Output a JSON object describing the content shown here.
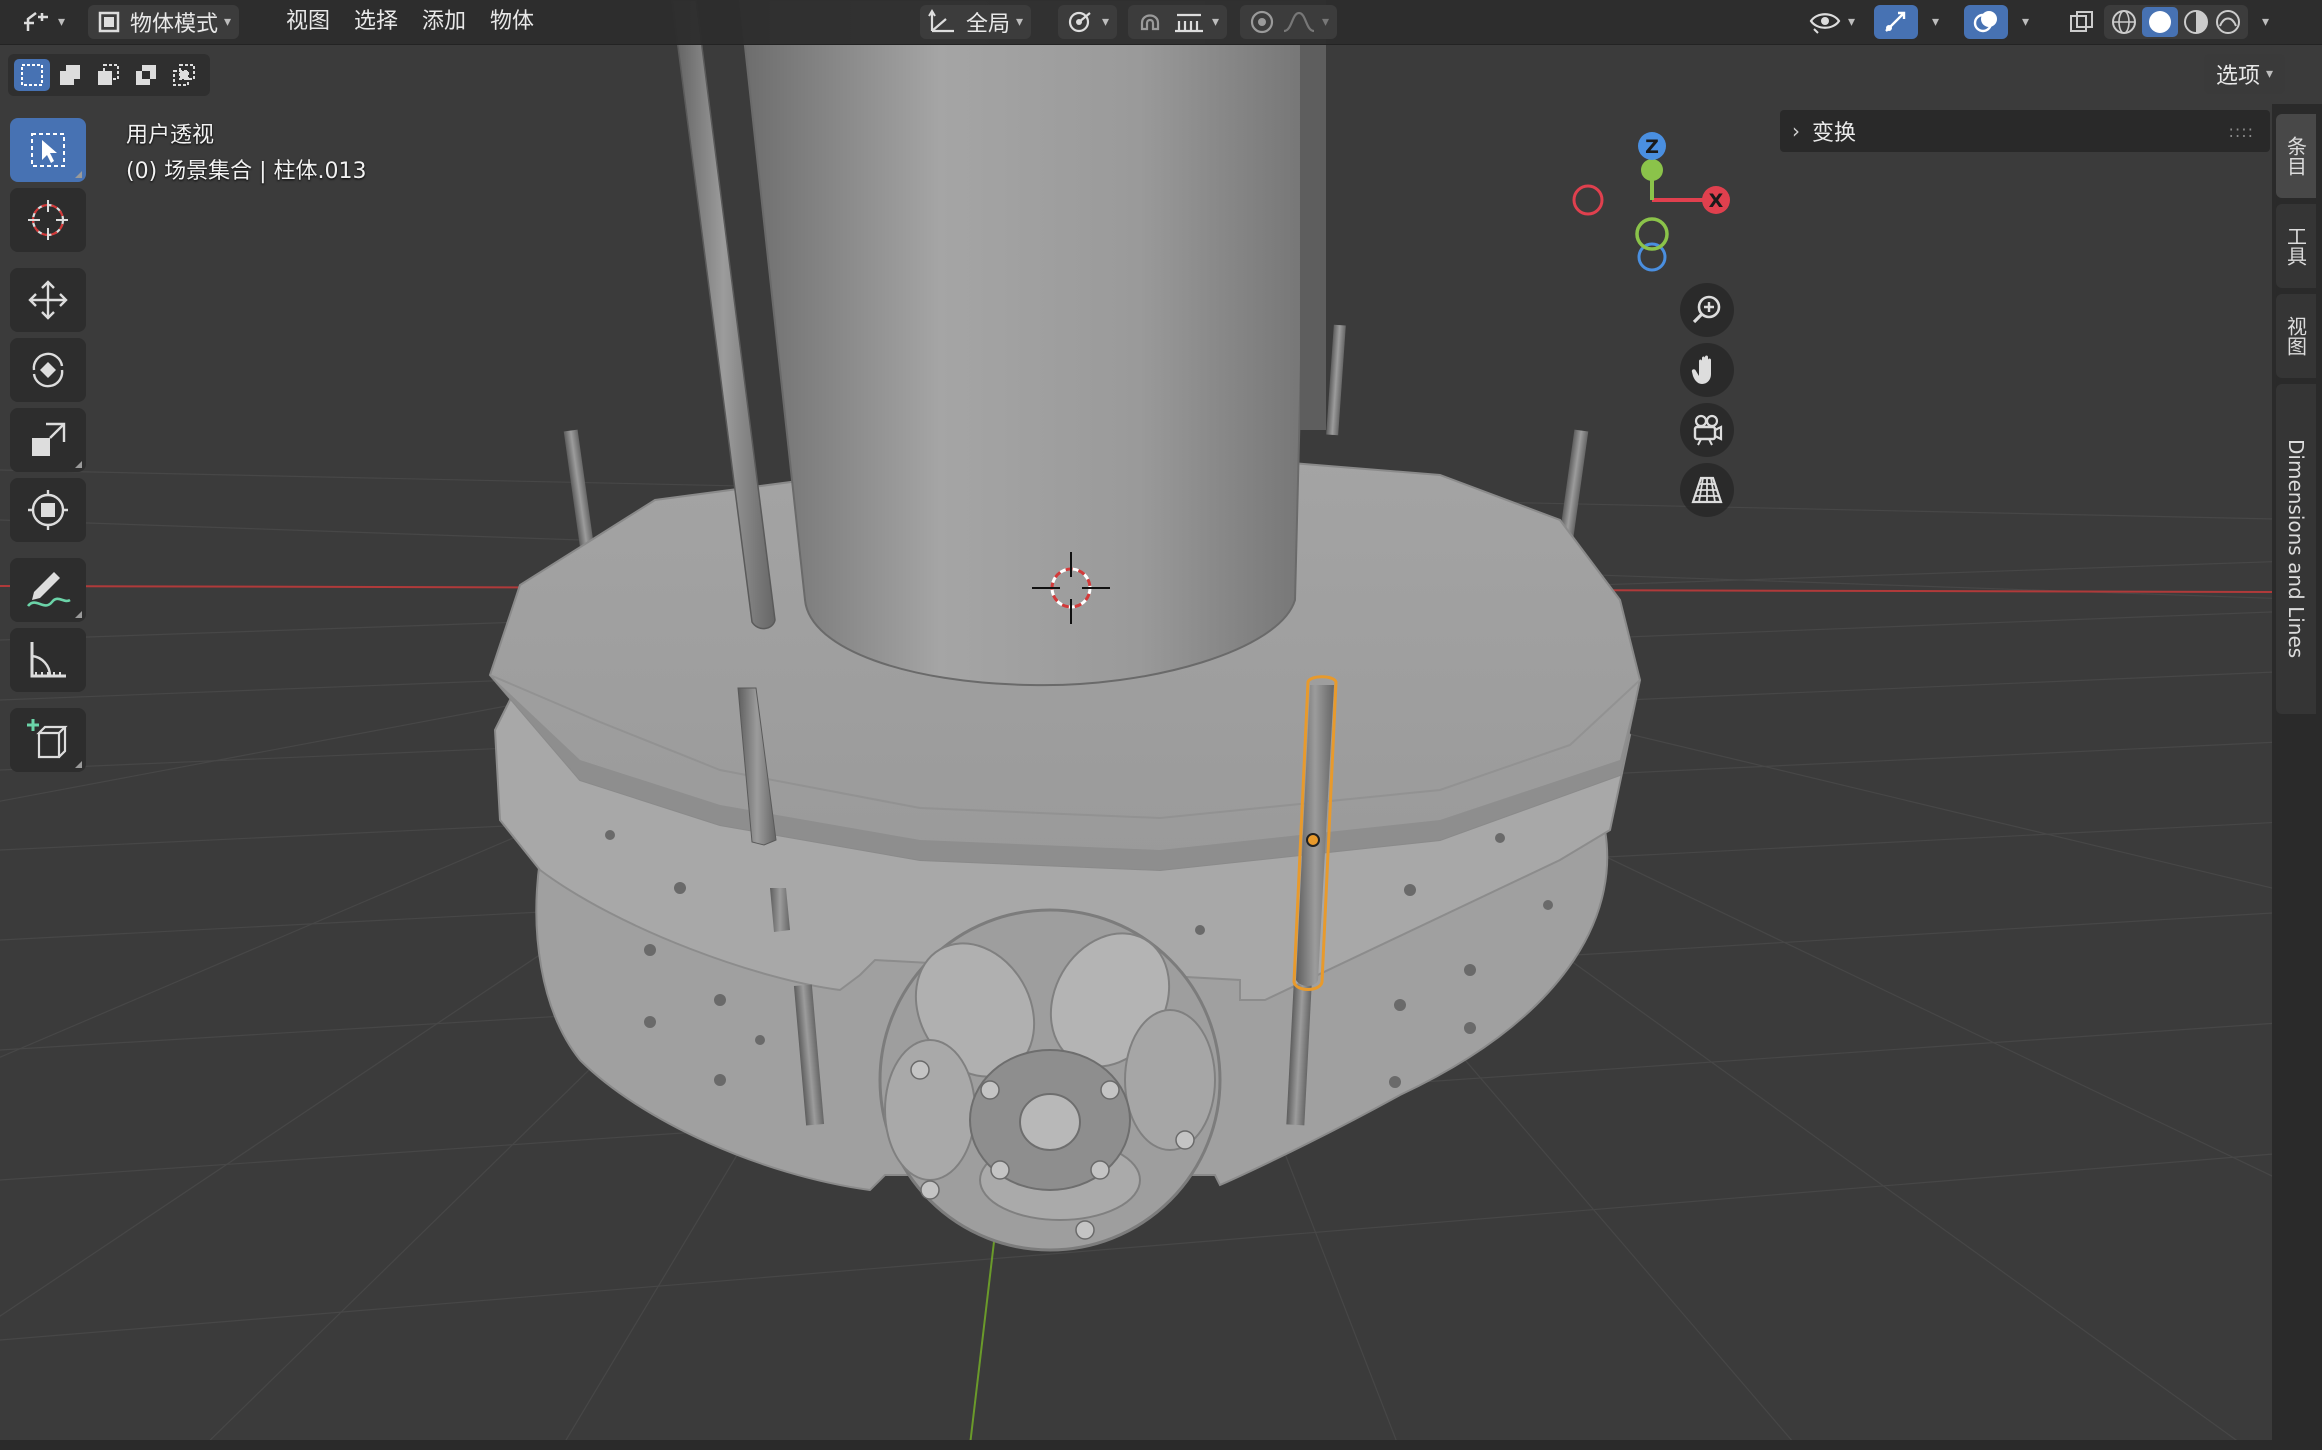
{
  "header": {
    "editor_type_icon": "editor-type-icon",
    "mode_label": "物体模式",
    "menus": [
      "视图",
      "选择",
      "添加",
      "物体"
    ],
    "transform_orientation": "全局",
    "options_label": "选项"
  },
  "viewport_info": {
    "line1": "用户透视",
    "line2": "(0) 场景集合 | 柱体.013"
  },
  "gizmo": {
    "z": "Z",
    "x": "X"
  },
  "npanel": {
    "section_title": "变换",
    "grip": "::::"
  },
  "side_tabs": [
    "条目",
    "工具",
    "视图",
    "Dimensions and Lines"
  ],
  "colors": {
    "accent": "#4772b3",
    "axis_x": "#e0404e",
    "axis_y": "#8bc34a",
    "axis_z": "#4a8fe0",
    "selection": "#e89a2c",
    "grid_red_line": "#b03a3a",
    "grid_green_line": "#6a9a2a"
  },
  "tools": [
    "select-box",
    "cursor",
    "move",
    "rotate",
    "scale",
    "transform",
    "annotate",
    "measure",
    "add-cube"
  ]
}
